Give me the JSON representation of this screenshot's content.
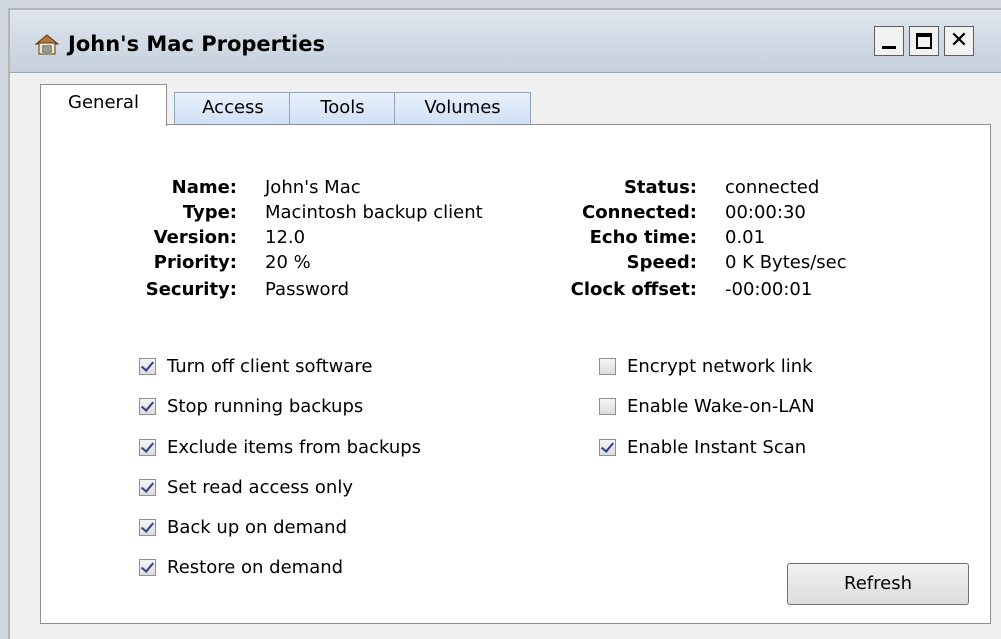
{
  "window": {
    "title": "John's Mac Properties"
  },
  "tabs": [
    {
      "label": "General",
      "active": true
    },
    {
      "label": "Access",
      "active": false
    },
    {
      "label": "Tools",
      "active": false
    },
    {
      "label": "Volumes",
      "active": false
    }
  ],
  "info_left": [
    {
      "label": "Name:",
      "value": "John's Mac"
    },
    {
      "label": "Type:",
      "value": "Macintosh backup client"
    },
    {
      "label": "Version:",
      "value": "12.0"
    },
    {
      "label": "Priority:",
      "value": "20 %"
    },
    {
      "label": "Security:",
      "value": "Password"
    }
  ],
  "info_right": [
    {
      "label": "Status:",
      "value": "connected"
    },
    {
      "label": "Connected:",
      "value": "00:00:30"
    },
    {
      "label": "Echo time:",
      "value": "0.01"
    },
    {
      "label": "Speed:",
      "value": "0 K Bytes/sec"
    },
    {
      "label": "Clock offset:",
      "value": "-00:00:01"
    }
  ],
  "checkboxes_left": [
    {
      "label": "Turn off client software",
      "checked": true
    },
    {
      "label": "Stop running backups",
      "checked": true
    },
    {
      "label": "Exclude items from backups",
      "checked": true
    },
    {
      "label": "Set read access only",
      "checked": true
    },
    {
      "label": "Back up on demand",
      "checked": true
    },
    {
      "label": "Restore on demand",
      "checked": true
    }
  ],
  "checkboxes_right": [
    {
      "label": "Encrypt network link",
      "checked": false
    },
    {
      "label": "Enable Wake-on-LAN",
      "checked": false
    },
    {
      "label": "Enable Instant Scan",
      "checked": true
    }
  ],
  "buttons": {
    "refresh": "Refresh"
  },
  "icons": {
    "title": "properties-icon",
    "minimize": "minimize-icon",
    "maximize": "maximize-icon",
    "close": "close-icon"
  }
}
